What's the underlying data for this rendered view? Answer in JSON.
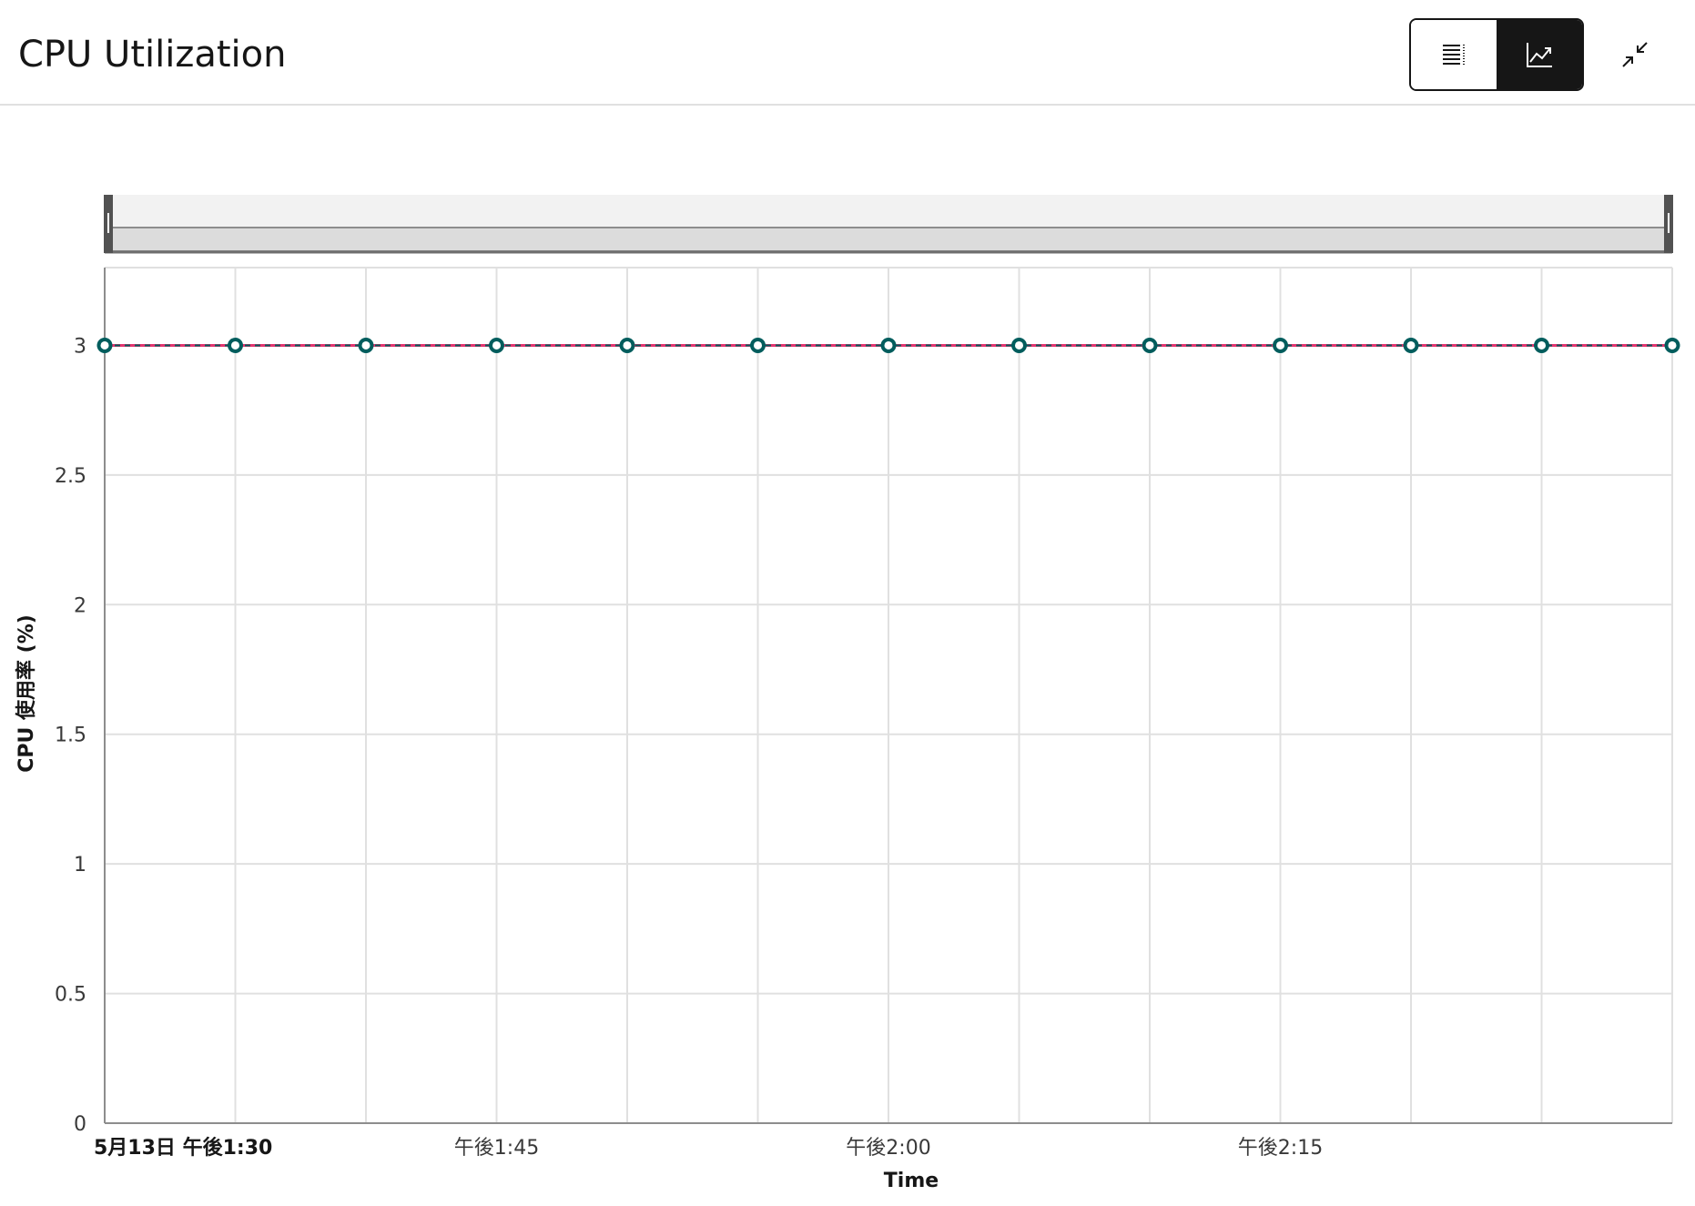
{
  "header": {
    "title": "CPU Utilization",
    "icons": {
      "table_view": "list-icon",
      "chart_view": "line-chart-icon",
      "minimize": "minimize-icon"
    }
  },
  "chart_data": {
    "type": "line",
    "xlabel": "Time",
    "ylabel": "CPU 使用率 (%)",
    "x_range": [
      "13:30",
      "14:30"
    ],
    "ylim": [
      0,
      3.3
    ],
    "y_ticks": [
      "0",
      "0.5",
      "1",
      "1.5",
      "2",
      "2.5",
      "3"
    ],
    "x_ticks": [
      {
        "time": "13:30",
        "label": "5月13日 午後1:30",
        "bold": true
      },
      {
        "time": "13:45",
        "label": "午後1:45",
        "bold": false
      },
      {
        "time": "14:00",
        "label": "午後2:00",
        "bold": false
      },
      {
        "time": "14:15",
        "label": "午後2:15",
        "bold": false
      }
    ],
    "grid": true,
    "series": [
      {
        "x": [
          "13:30",
          "13:35",
          "13:40",
          "13:45",
          "13:50",
          "13:55",
          "14:00",
          "14:05",
          "14:10",
          "14:15",
          "14:20",
          "14:25",
          "14:30"
        ],
        "values": [
          3,
          3,
          3,
          3,
          3,
          3,
          3,
          3,
          3,
          3,
          3,
          3,
          3
        ]
      }
    ],
    "colors": {
      "line": "#e3346f",
      "marker": "#005d5d",
      "grid": "#e0e0e0",
      "axis": "#8d8d8d"
    },
    "zoom_bar": true
  }
}
